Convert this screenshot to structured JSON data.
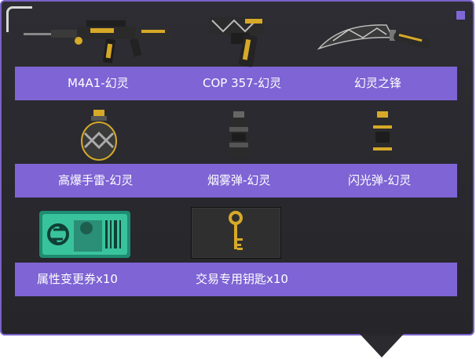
{
  "items": [
    {
      "name": "M4A1-幻灵",
      "icon": "rifle-icon"
    },
    {
      "name": "COP 357-幻灵",
      "icon": "pistol-icon"
    },
    {
      "name": "幻灵之锋",
      "icon": "knife-icon"
    },
    {
      "name": "高爆手雷-幻灵",
      "icon": "grenade-icon"
    },
    {
      "name": "烟雾弹-幻灵",
      "icon": "smoke-grenade-icon"
    },
    {
      "name": "闪光弹-幻灵",
      "icon": "flash-grenade-icon"
    },
    {
      "name": "属性变更券x10",
      "icon": "ticket-icon"
    },
    {
      "name": "交易专用钥匙x10",
      "icon": "key-icon"
    }
  ],
  "colors": {
    "accent": "#7e64d4",
    "panel_bg": "#2b2b30",
    "gold": "#d6a928"
  }
}
